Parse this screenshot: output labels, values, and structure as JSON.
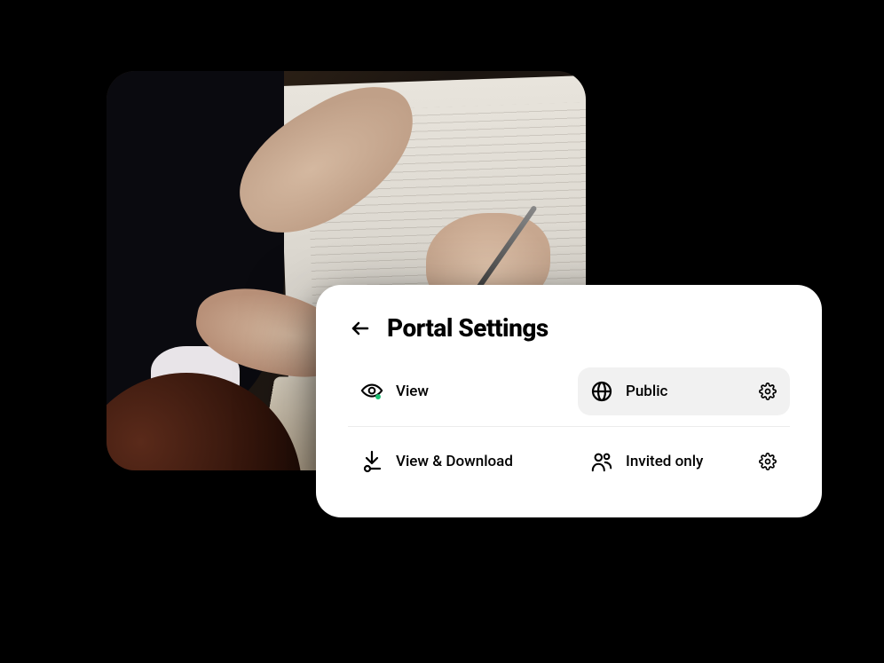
{
  "card": {
    "title": "Portal Settings",
    "rows": [
      {
        "left": {
          "icon": "eye-dot-icon",
          "label": "View",
          "selected": false,
          "trailing": null
        },
        "right": {
          "icon": "globe-icon",
          "label": "Public",
          "selected": true,
          "trailing": "gear-icon"
        }
      },
      {
        "left": {
          "icon": "download-icon",
          "label": "View & Download",
          "selected": false,
          "trailing": null
        },
        "right": {
          "icon": "users-icon",
          "label": "Invited only",
          "selected": false,
          "trailing": "gear-icon"
        }
      }
    ]
  },
  "colors": {
    "accent_dot": "#1bbf72",
    "card_bg": "#ffffff",
    "selected_bg": "#f1f1f1"
  }
}
